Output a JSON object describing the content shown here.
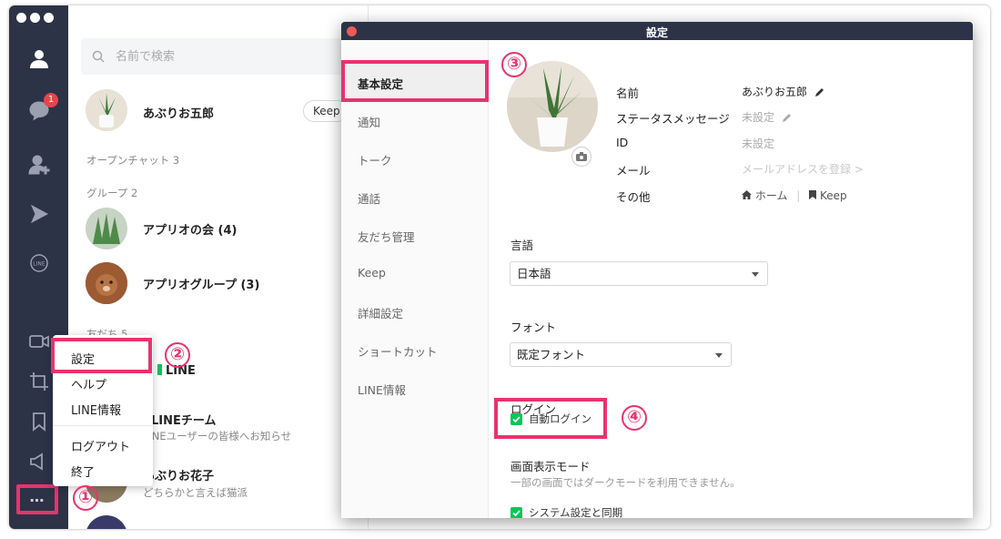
{
  "window": {
    "badge_count": "1",
    "more_label": "…"
  },
  "search": {
    "placeholder": "名前で検索"
  },
  "profile_row": {
    "name": "あぶりお五郎",
    "keep_label": "Keep"
  },
  "sections": {
    "open_chat": "オープンチャット 3",
    "groups": "グループ 2",
    "friends": "友だち 5"
  },
  "groups": [
    {
      "name": "アプリオの会 (4)"
    },
    {
      "name": "アプリオグループ (3)"
    }
  ],
  "friends": [
    {
      "name": "LINE",
      "sub": ""
    },
    {
      "name": "LINEチーム",
      "sub": "LINEユーザーの皆様へお知らせ"
    },
    {
      "name": "あぶりお花子",
      "sub": "どちらかと言えば猫派"
    }
  ],
  "menu": {
    "items": [
      "設定",
      "ヘルプ",
      "LINE情報",
      "ログアウト",
      "終了"
    ]
  },
  "callouts": [
    "①",
    "②",
    "③",
    "④"
  ],
  "settings": {
    "title": "設定",
    "nav": [
      "基本設定",
      "通知",
      "トーク",
      "通話",
      "友だち管理",
      "Keep",
      "詳細設定",
      "ショートカット",
      "LINE情報"
    ],
    "profile": {
      "labels": [
        "名前",
        "ステータスメッセージ",
        "ID",
        "メール",
        "その他"
      ],
      "name_value": "あぶりお五郎",
      "status_value": "未設定",
      "id_value": "未設定",
      "mail_value": "メールアドレスを登録 >",
      "home_link": "ホーム",
      "keep_link": "Keep"
    },
    "language": {
      "label": "言語",
      "value": "日本語"
    },
    "font": {
      "label": "フォント",
      "value": "既定フォント"
    },
    "login": {
      "label": "ログイン",
      "auto_login": "自動ログイン",
      "checked": true
    },
    "display_mode": {
      "label": "画面表示モード",
      "note": "一部の画面ではダークモードを利用できません。",
      "sync_label": "システム設定と同期"
    }
  }
}
